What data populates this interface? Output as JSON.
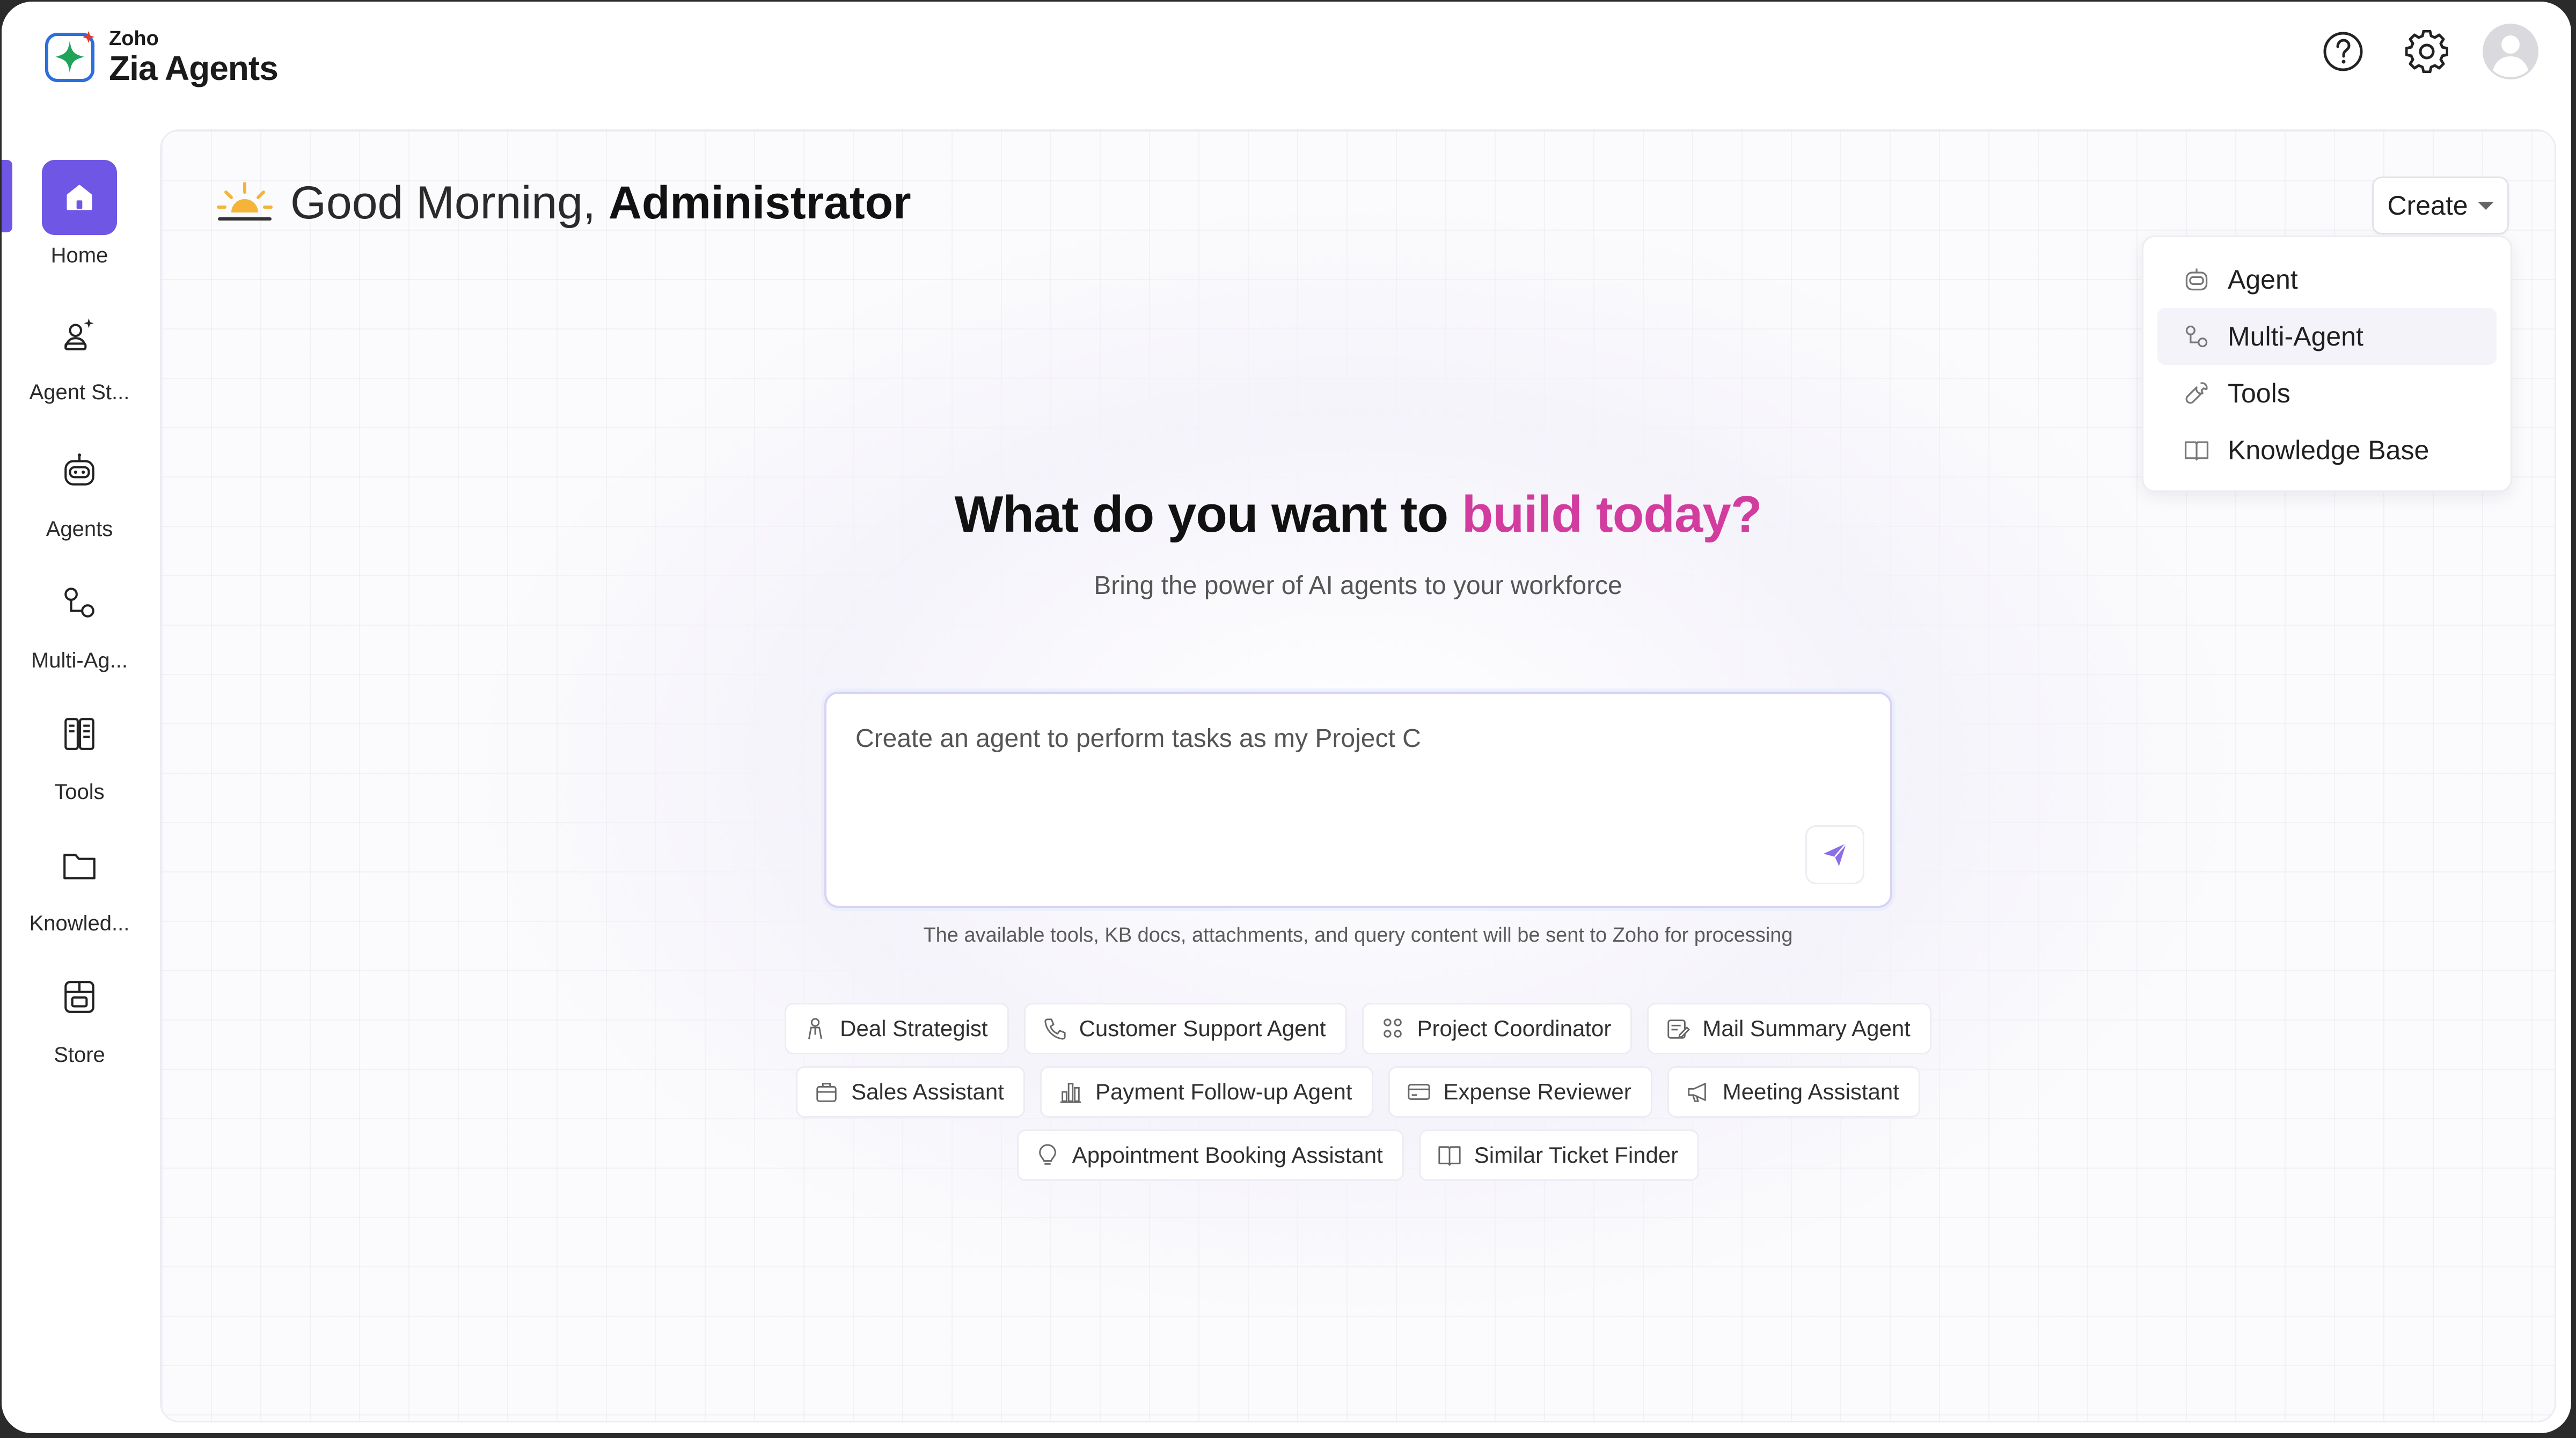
{
  "app": {
    "brand": "Zoho",
    "product": "Zia Agents"
  },
  "header": {
    "help_icon": "help-icon",
    "settings_icon": "gear-icon",
    "avatar_icon": "user-avatar-icon"
  },
  "sidebar": {
    "items": [
      {
        "label": "Home",
        "icon": "home-icon",
        "active": true
      },
      {
        "label": "Agent St...",
        "icon": "agent-studio-icon",
        "active": false
      },
      {
        "label": "Agents",
        "icon": "robot-icon",
        "active": false
      },
      {
        "label": "Multi-Ag...",
        "icon": "multi-agent-icon",
        "active": false
      },
      {
        "label": "Tools",
        "icon": "tools-icon",
        "active": false
      },
      {
        "label": "Knowled...",
        "icon": "folder-icon",
        "active": false
      },
      {
        "label": "Store",
        "icon": "store-icon",
        "active": false
      }
    ]
  },
  "main": {
    "greeting_prefix": "Good Morning,",
    "greeting_name": "Administrator",
    "create_button": "Create",
    "create_menu": [
      {
        "label": "Agent",
        "icon": "robot-icon"
      },
      {
        "label": "Multi-Agent",
        "icon": "multi-agent-icon"
      },
      {
        "label": "Tools",
        "icon": "wrench-icon"
      },
      {
        "label": "Knowledge Base",
        "icon": "book-icon"
      }
    ],
    "hero_title_plain": "What do you want to",
    "hero_title_accent": "build today?",
    "hero_subtitle": "Bring the power of AI agents to your workforce",
    "prompt_value": "Create an agent to perform tasks as my Project C",
    "disclaimer": "The available tools, KB docs, attachments, and query content will be sent to Zoho for processing",
    "suggestions": [
      [
        "Deal Strategist",
        "Customer Support Agent",
        "Project Coordinator",
        "Mail Summary Agent"
      ],
      [
        "Sales Assistant",
        "Payment Follow-up Agent",
        "Expense Reviewer",
        "Meeting Assistant"
      ],
      [
        "Appointment Booking Assistant",
        "Similar Ticket Finder"
      ]
    ]
  },
  "colors": {
    "accent": "#6f56e5",
    "headline_accent": "#d13c9e",
    "sun": "#f4b43a"
  }
}
